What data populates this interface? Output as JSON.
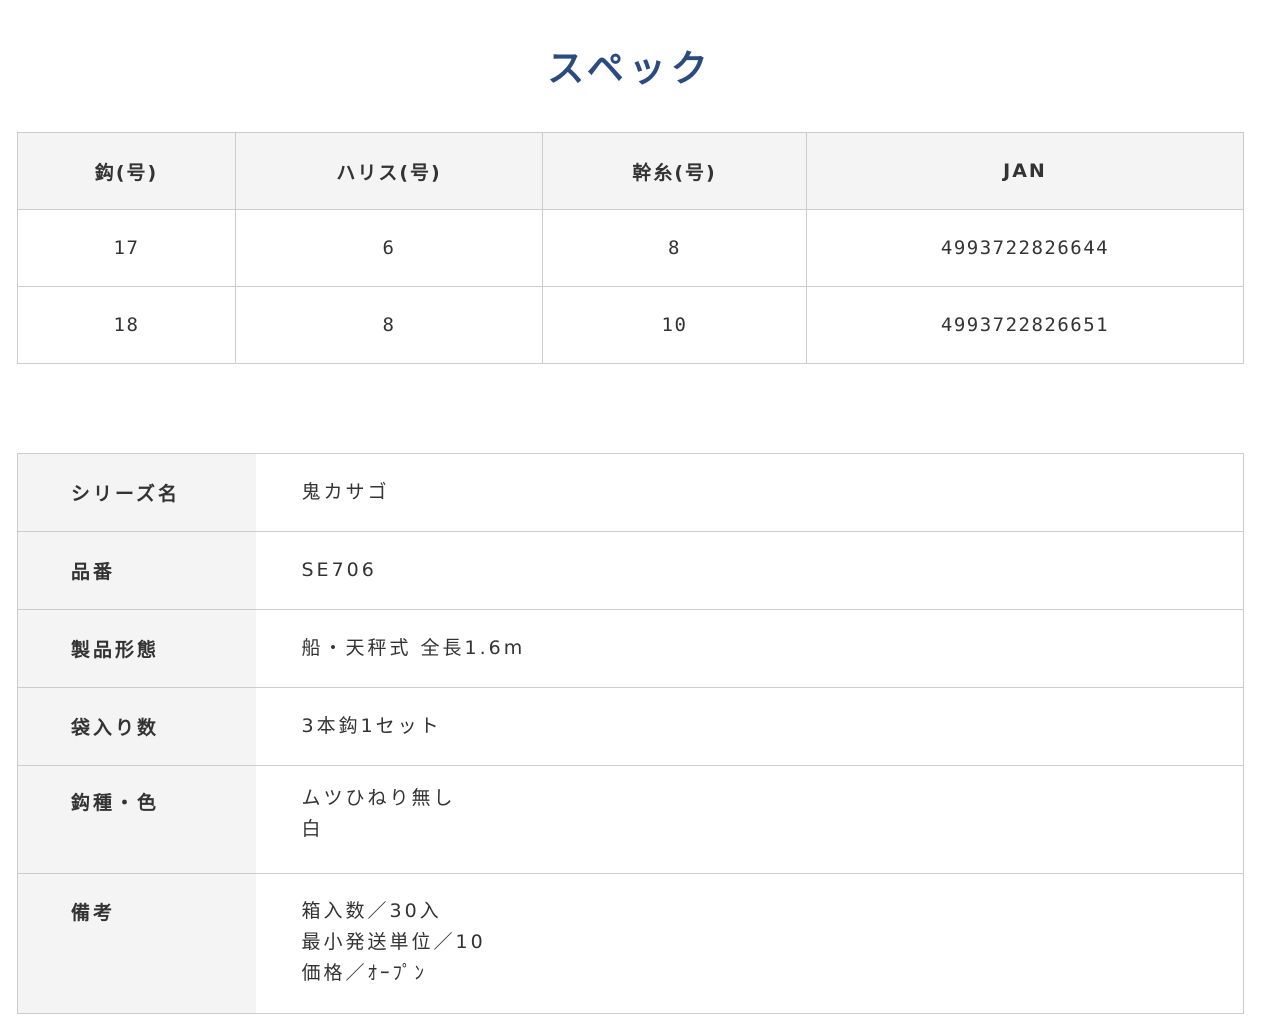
{
  "page": {
    "title": "スペック"
  },
  "spec_table": {
    "headers": [
      "鈎(号)",
      "ハリス(号)",
      "幹糸(号)",
      "JAN"
    ],
    "rows": [
      [
        "17",
        "6",
        "8",
        "4993722826644"
      ],
      [
        "18",
        "8",
        "10",
        "4993722826651"
      ]
    ]
  },
  "detail_table": {
    "rows": [
      {
        "label": "シリーズ名",
        "values": [
          "鬼カサゴ"
        ]
      },
      {
        "label": "品番",
        "values": [
          "SE706"
        ]
      },
      {
        "label": "製品形態",
        "values": [
          "船・天秤式 全長1.6m"
        ]
      },
      {
        "label": "袋入り数",
        "values": [
          "3本鈎1セット"
        ]
      },
      {
        "label": "鈎種・色",
        "values": [
          "ムツひねり無し",
          "白"
        ]
      },
      {
        "label": "備考",
        "values": [
          "箱入数／30入",
          "最小発送単位／10",
          "価格／ｵｰﾌﾟﾝ"
        ]
      }
    ]
  }
}
